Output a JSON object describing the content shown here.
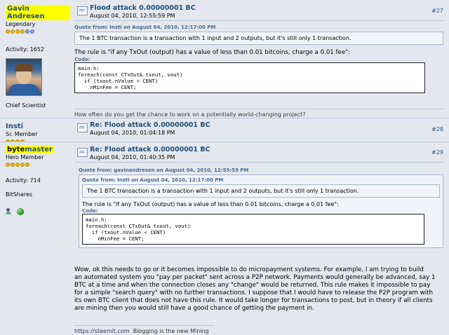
{
  "posts": [
    {
      "author": {
        "name": "Gavin Andresen",
        "rank": "Legendary",
        "activity_label": "Activity:",
        "activity_value": "1652",
        "title": "Chief Scientist"
      },
      "header": {
        "title": "Flood attack 0.00000001 BC",
        "date": "August 04, 2010, 12:55:59 PM",
        "num": "#27"
      },
      "quote": {
        "header": "Quote from: Insti on August 04, 2010, 12:17:00 PM",
        "text": "The 1 BTC transaction is a transaction with 1 input and 2 outputs, but it's still only 1 transaction."
      },
      "text": "The rule is \"if any TxOut (output) has a value of less than 0.01 bitcoins, charge a 0.01 fee\":",
      "code_label": "Code:",
      "code": [
        "main.h:",
        "foreach(const CTxOut& txout, vout)",
        "  if (txout.nValue < CENT)",
        "    nMinFee = CENT;"
      ],
      "signature": "How often do you get the chance to work on a potentially world-changing project?"
    },
    {
      "author": {
        "name": "Insti",
        "rank": "Sr. Member"
      },
      "header": {
        "title": "Re: Flood attack 0.00000001 BC",
        "date": "August 04, 2010, 01:04:18 PM",
        "num": "#28"
      }
    },
    {
      "author": {
        "name_part1": "byte",
        "name_part2": "master",
        "rank": "Hero Member",
        "activity_label": "Activity:",
        "activity_value": "714",
        "title": "BitShares"
      },
      "header": {
        "title": "Re: Flood attack 0.00000001 BC",
        "date": "August 04, 2010, 01:40:35 PM",
        "num": "#29"
      },
      "outer_quote": {
        "header": "Quote from: gavinandresen on August 04, 2010, 12:55:59 PM"
      },
      "inner_quote": {
        "header": "Quote from: Insti on August 04, 2010, 12:17:00 PM",
        "text": "The 1 BTC transaction is a transaction with 1 input and 2 outputs, but it's still only 1 transaction."
      },
      "quote_text": "The rule is \"if any TxOut (output) has a value of less than 0.01 bitcoins, charge a 0.01 fee\":",
      "code_label": "Code:",
      "code": [
        "main.h:",
        "foreach(const CTxOut& txout, vout)",
        "  if (txout.nValue < CENT)",
        "    nMinFee = CENT;"
      ],
      "body": [
        "Wow, ok this needs to go or it becomes impossible to do micropayment systems.    For example, I am trying to build",
        "an automated system you \"pay per packet\" sent across a P2P network.  Payments would generally be advanced, say 1",
        "BTC at a time and when the connection closes any \"change\" would be returned.  This rule makes it impossible to pay",
        "for a simple \"search query\" with no further transactions.   I suppose that I would have to release the P2P program with",
        "its own BTC client that does not have this rule.  It would take longer for transactions to post, but in theory if all clients",
        "are mining then you would still have a good chance of getting the payment in."
      ],
      "sig_link": "https://steemit.com",
      "sig_text": "Blogging is the new Mining"
    }
  ]
}
